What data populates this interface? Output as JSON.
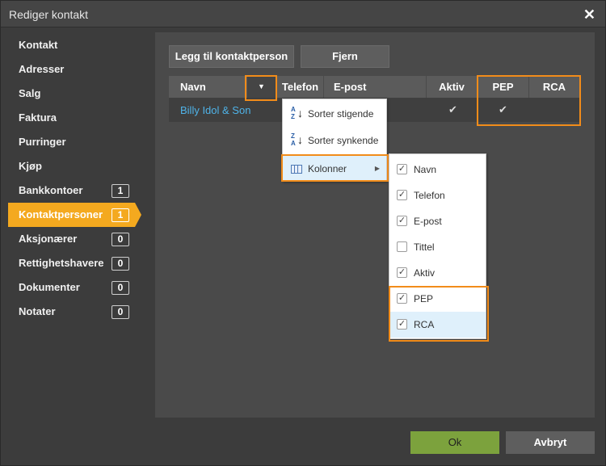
{
  "window": {
    "title": "Rediger kontakt",
    "close_label": "✕"
  },
  "sidebar": {
    "items": [
      {
        "label": "Kontakt",
        "badge": null
      },
      {
        "label": "Adresser",
        "badge": null
      },
      {
        "label": "Salg",
        "badge": null
      },
      {
        "label": "Faktura",
        "badge": null
      },
      {
        "label": "Purringer",
        "badge": null
      },
      {
        "label": "Kjøp",
        "badge": null
      },
      {
        "label": "Bankkontoer",
        "badge": "1"
      },
      {
        "label": "Kontaktpersoner",
        "badge": "1",
        "active": true
      },
      {
        "label": "Aksjonærer",
        "badge": "0"
      },
      {
        "label": "Rettighetshavere",
        "badge": "0"
      },
      {
        "label": "Dokumenter",
        "badge": "0"
      },
      {
        "label": "Notater",
        "badge": "0"
      }
    ]
  },
  "toolbar": {
    "add_label": "Legg til kontaktperson",
    "remove_label": "Fjern"
  },
  "grid": {
    "columns": {
      "navn": "Navn",
      "telefon": "Telefon",
      "epost": "E-post",
      "aktiv": "Aktiv",
      "pep": "PEP",
      "rca": "RCA"
    },
    "rows": [
      {
        "navn": "Billy Idol & Son",
        "telefon": "",
        "epost": "",
        "aktiv": "✔",
        "pep": "✔",
        "rca": ""
      }
    ]
  },
  "column_menu": {
    "sort_asc": "Sorter stigende",
    "sort_desc": "Sorter synkende",
    "columns": "Kolonner",
    "sort_asc_letters": [
      "A",
      "Z"
    ],
    "sort_desc_letters": [
      "Z",
      "A"
    ]
  },
  "columns_submenu": [
    {
      "label": "Navn",
      "checked": true
    },
    {
      "label": "Telefon",
      "checked": true
    },
    {
      "label": "E-post",
      "checked": true
    },
    {
      "label": "Tittel",
      "checked": false
    },
    {
      "label": "Aktiv",
      "checked": true
    },
    {
      "label": "PEP",
      "checked": true
    },
    {
      "label": "RCA",
      "checked": true
    }
  ],
  "footer": {
    "ok_label": "Ok",
    "cancel_label": "Avbryt"
  },
  "colors": {
    "accent": "#f4a91f",
    "highlight_outline": "#f28c1a",
    "link": "#4fb3e8",
    "ok_button": "#7ca23d"
  }
}
